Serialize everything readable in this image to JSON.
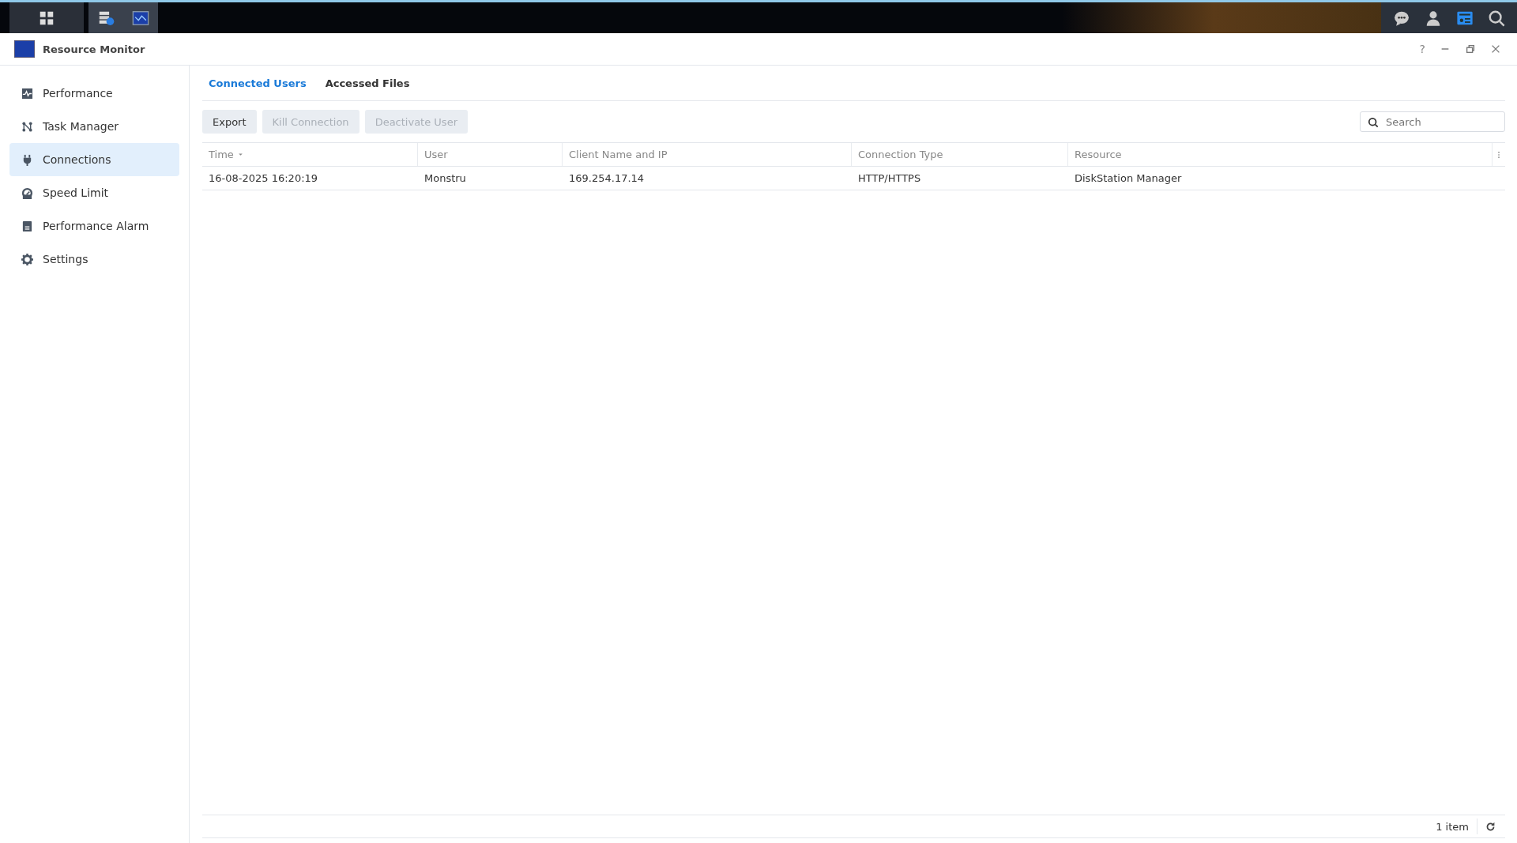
{
  "taskbar": {
    "apps": [
      {
        "kind": "apps",
        "active": false
      },
      {
        "kind": "storage",
        "active": true
      },
      {
        "kind": "monitor",
        "active": true
      }
    ],
    "tray": [
      {
        "kind": "chat"
      },
      {
        "kind": "user"
      },
      {
        "kind": "widgets"
      },
      {
        "kind": "search"
      }
    ]
  },
  "window": {
    "title": "Resource Monitor",
    "help": "?"
  },
  "sidebar": {
    "items": [
      {
        "label": "Performance",
        "selected": false
      },
      {
        "label": "Task Manager",
        "selected": false
      },
      {
        "label": "Connections",
        "selected": true
      },
      {
        "label": "Speed Limit",
        "selected": false
      },
      {
        "label": "Performance Alarm",
        "selected": false
      },
      {
        "label": "Settings",
        "selected": false
      }
    ]
  },
  "tabs": [
    {
      "label": "Connected Users",
      "selected": true
    },
    {
      "label": "Accessed Files",
      "selected": false
    }
  ],
  "toolbar": {
    "buttons": [
      {
        "label": "Export",
        "disabled": false
      },
      {
        "label": "Kill Connection",
        "disabled": true
      },
      {
        "label": "Deactivate User",
        "disabled": true
      }
    ],
    "search": {
      "placeholder": "Search"
    }
  },
  "table": {
    "columns": [
      {
        "label": "Time",
        "sorted": true
      },
      {
        "label": "User",
        "sorted": false
      },
      {
        "label": "Client Name and IP",
        "sorted": false
      },
      {
        "label": "Connection Type",
        "sorted": false
      },
      {
        "label": "Resource",
        "sorted": false
      }
    ],
    "rows": [
      [
        "16-08-2025 16:20:19",
        "Monstru",
        "169.254.17.14",
        "HTTP/HTTPS",
        "DiskStation Manager"
      ]
    ]
  },
  "status_bar": {
    "count": "1 item"
  }
}
